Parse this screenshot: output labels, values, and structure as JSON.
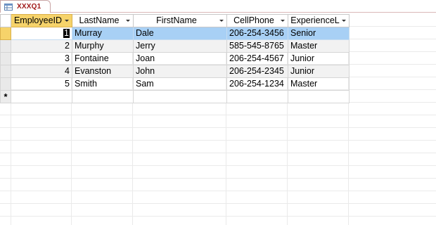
{
  "tab": {
    "title": "XXXQ1",
    "icon": "query-icon"
  },
  "columns": [
    {
      "key": "EmployeeID",
      "label": "EmployeeID",
      "align": "right"
    },
    {
      "key": "LastName",
      "label": "LastName",
      "align": "left"
    },
    {
      "key": "FirstName",
      "label": "FirstName",
      "align": "left"
    },
    {
      "key": "CellPhone",
      "label": "CellPhone",
      "align": "left"
    },
    {
      "key": "ExperienceL",
      "label": "ExperienceL",
      "align": "left"
    }
  ],
  "rows": [
    {
      "EmployeeID": "1",
      "LastName": "Murray",
      "FirstName": "Dale",
      "CellPhone": "206-254-3456",
      "ExperienceL": "Senior"
    },
    {
      "EmployeeID": "2",
      "LastName": "Murphy",
      "FirstName": "Jerry",
      "CellPhone": "585-545-8765",
      "ExperienceL": "Master"
    },
    {
      "EmployeeID": "3",
      "LastName": "Fontaine",
      "FirstName": "Joan",
      "CellPhone": "206-254-4567",
      "ExperienceL": "Junior"
    },
    {
      "EmployeeID": "4",
      "LastName": "Evanston",
      "FirstName": "John",
      "CellPhone": "206-254-2345",
      "ExperienceL": "Junior"
    },
    {
      "EmployeeID": "5",
      "LastName": "Smith",
      "FirstName": "Sam",
      "CellPhone": "206-254-1234",
      "ExperienceL": "Master"
    }
  ],
  "new_record_marker": "*",
  "selected_row": 0,
  "colors": {
    "header_selected": "#f6d36a",
    "row_selected": "#a8d0f5",
    "tab_text": "#a01818"
  }
}
